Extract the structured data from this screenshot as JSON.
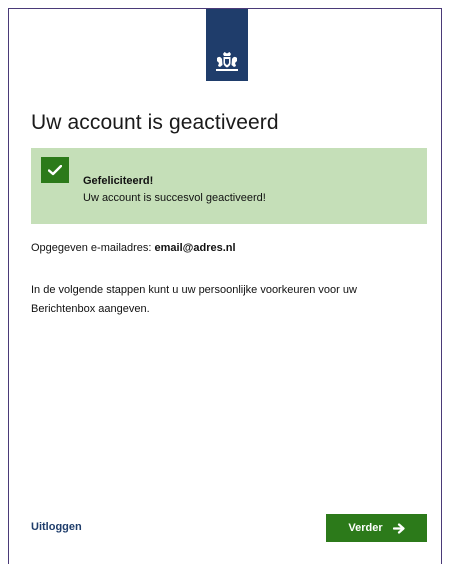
{
  "page": {
    "title": "Uw account is geactiveerd"
  },
  "success": {
    "heading": "Gefeliciteerd!",
    "message": "Uw account is succesvol geactiveerd!"
  },
  "email": {
    "label": "Opgegeven e-mailadres:",
    "value": "email@adres.nl"
  },
  "info": {
    "text": "In de volgende stappen kunt u uw persoonlijke voorkeuren voor uw Berichtenbox aangeven."
  },
  "actions": {
    "logout_label": "Uitloggen",
    "next_label": "Verder"
  },
  "colors": {
    "brand_blue": "#1f3d6b",
    "success_green": "#2c7a1a",
    "success_bg": "#c5dfb8"
  },
  "icons": {
    "logo": "rijksoverheid-logo-icon",
    "check": "check-icon",
    "arrow": "arrow-right-icon"
  }
}
